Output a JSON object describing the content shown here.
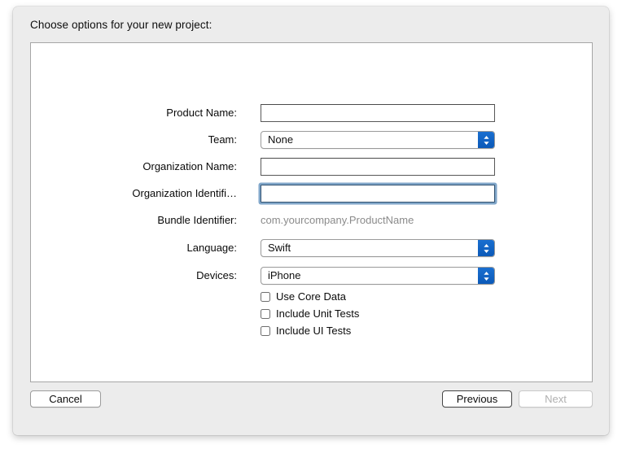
{
  "window": {
    "sheet_title": "Choose options for your new project:"
  },
  "form": {
    "rows": [
      {
        "label": "Product Name:",
        "type": "textfield",
        "value": "",
        "focused": false
      },
      {
        "label": "Team:",
        "type": "popup",
        "value": "None"
      },
      {
        "label": "Organization Name:",
        "type": "textfield",
        "value": "",
        "focused": false
      },
      {
        "label": "Organization Identifi…",
        "type": "textfield",
        "value": "",
        "focused": true
      },
      {
        "label": "Bundle Identifier:",
        "type": "static",
        "value": "com.yourcompany.ProductName"
      },
      {
        "label": "Language:",
        "type": "popup",
        "value": "Swift"
      },
      {
        "label": "Devices:",
        "type": "popup",
        "value": "iPhone"
      }
    ],
    "checkboxes": [
      {
        "label": "Use Core Data",
        "checked": false
      },
      {
        "label": "Include Unit Tests",
        "checked": false
      },
      {
        "label": "Include UI Tests",
        "checked": false
      }
    ]
  },
  "buttons": {
    "cancel": "Cancel",
    "previous": "Previous",
    "next": "Next"
  },
  "colors": {
    "window_background": "#ececec",
    "panel_background": "#ffffff",
    "accent_blue": "#0b59b8",
    "focus_ring": "#6a96bf",
    "placeholder_text": "#8b8b8b",
    "disabled_text": "#b0b0b0"
  }
}
